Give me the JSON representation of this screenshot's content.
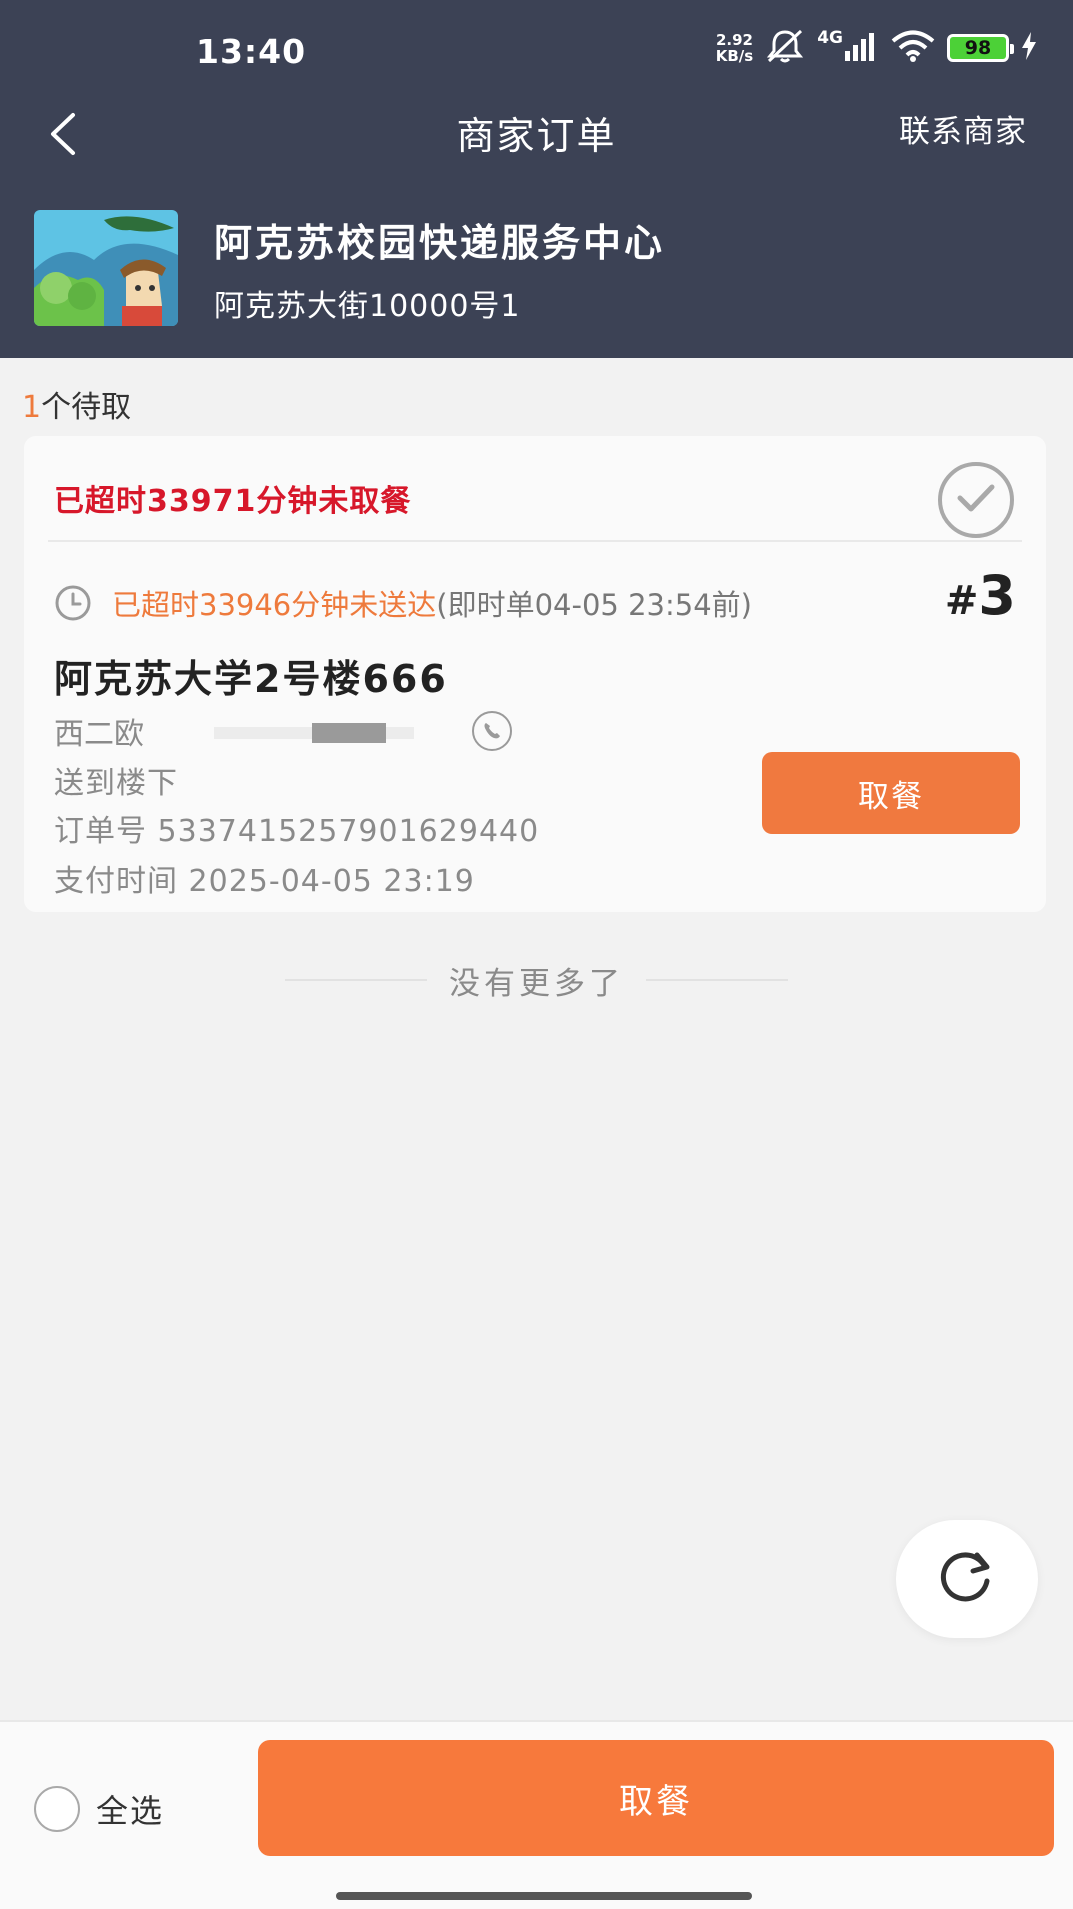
{
  "status_bar": {
    "time": "13:40",
    "net_speed_value": "2.92",
    "net_speed_unit": "KB/s",
    "network": "4G",
    "battery": "98"
  },
  "nav": {
    "title": "商家订单",
    "contact_label": "联系商家"
  },
  "merchant": {
    "name": "阿克苏校园快递服务中心",
    "address": "阿克苏大街10000号1"
  },
  "pending": {
    "count": "1",
    "label": "个待取"
  },
  "order": {
    "overdue_pickup": "已超时33971分钟未取餐",
    "overdue_delivery": "已超时33946分钟未送达",
    "delivery_meta": "(即时单04-05 23:54前)",
    "number_hash": "#",
    "number": "3",
    "address": "阿克苏大学2号楼666",
    "customer_name": "西二欧",
    "delivery_note": "送到楼下",
    "order_no_label": "订单号",
    "order_no": "5337415257901629440",
    "pay_time_label": "支付时间",
    "pay_time": "2025-04-05 23:19",
    "pickup_label": "取餐"
  },
  "list_end": "没有更多了",
  "bottom": {
    "select_all": "全选",
    "pickup_label": "取餐"
  },
  "colors": {
    "header_bg": "#3c4255",
    "accent_orange": "#f0793f",
    "alert_red": "#d7172a"
  }
}
